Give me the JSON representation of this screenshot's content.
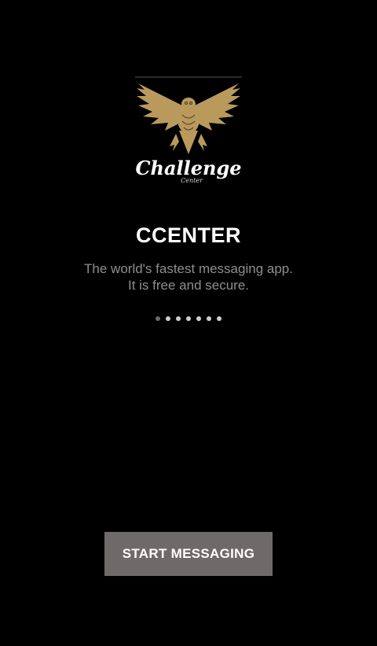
{
  "logo": {
    "icon": "eagle-logo-icon",
    "text": "Challenge",
    "subtext": "Center",
    "color": "#b99a5c"
  },
  "title": "CCENTER",
  "subtitle": {
    "line1": "The world's fastest messaging app.",
    "line2": "It is free and secure."
  },
  "pager": {
    "count": 7,
    "active_index": 0
  },
  "start_button": {
    "label": "START MESSAGING",
    "color": "#6e6a6a"
  }
}
